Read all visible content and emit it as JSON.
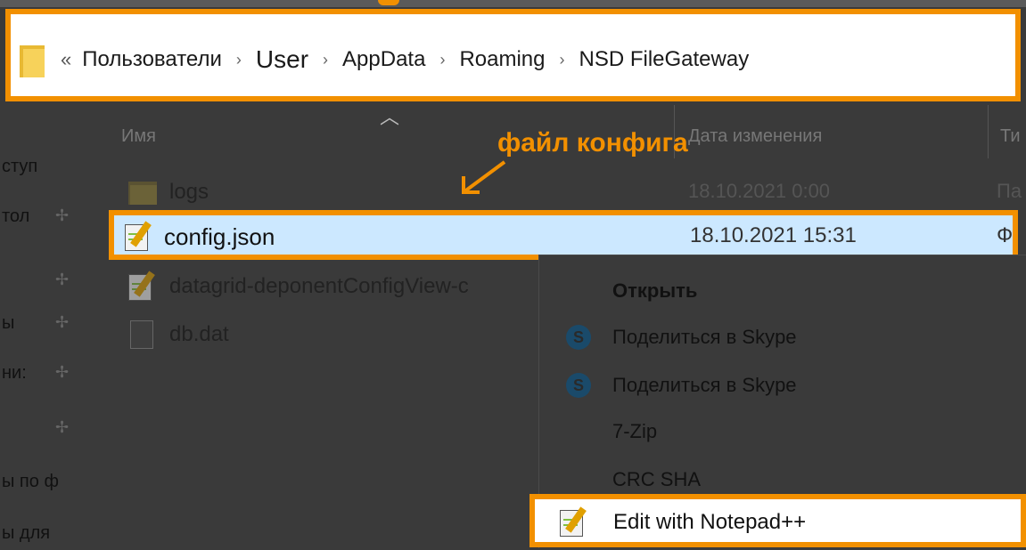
{
  "address_bar": {
    "overflow_chevron": "«",
    "crumbs": [
      "Пользователи",
      "User",
      "AppData",
      "Roaming",
      "NSD FileGateway"
    ],
    "separator": "›"
  },
  "columns": {
    "name": "Имя",
    "date": "Дата изменения",
    "type": "Ти"
  },
  "annotation": "файл конфига",
  "nav_pane": {
    "items": [
      "ступ",
      "тол",
      "ы",
      "ни:",
      "ы по ф",
      "ы для"
    ]
  },
  "files": [
    {
      "name": "logs",
      "date": "18.10.2021 0:00",
      "type": "Па",
      "icon": "folder-icon"
    },
    {
      "name": "config.json",
      "date": "18.10.2021 15:31",
      "type": "Ф",
      "icon": "notepadpp-icon",
      "selected": true
    },
    {
      "name": "datagrid-deponentConfigView-c",
      "date": "",
      "type": "",
      "icon": "notepadpp-icon"
    },
    {
      "name": "db.dat",
      "date": "",
      "type": "",
      "icon": "file-icon"
    }
  ],
  "context_menu": {
    "items": [
      {
        "label": "Открыть",
        "bold": true,
        "icon": ""
      },
      {
        "label": "Поделиться в Skype",
        "icon": "skype-icon"
      },
      {
        "label": "Поделиться в Skype",
        "icon": "skype-icon"
      },
      {
        "label": "7-Zip",
        "icon": ""
      },
      {
        "label": "CRC SHA",
        "icon": ""
      },
      {
        "label": "Edit with Notepad++",
        "icon": "notepadpp-icon",
        "highlighted": true
      }
    ]
  },
  "colors": {
    "highlight_orange": "#f29000",
    "selection_blue": "#cce8ff",
    "dim_background": "#3a3a3a"
  }
}
